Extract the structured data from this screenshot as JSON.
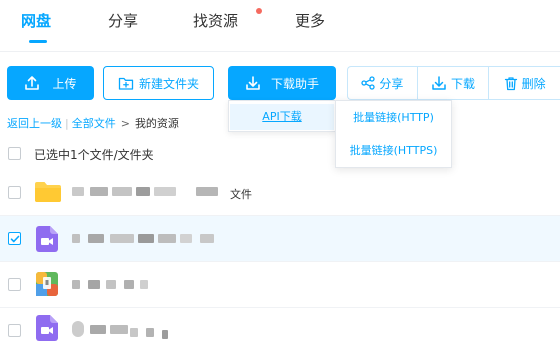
{
  "nav": {
    "tabs": [
      {
        "label": "网盘",
        "active": true
      },
      {
        "label": "分享",
        "active": false
      },
      {
        "label": "找资源",
        "active": false,
        "badge": "red-dot"
      },
      {
        "label": "更多",
        "active": false
      }
    ]
  },
  "toolbar": {
    "upload_label": "上传",
    "new_folder_label": "新建文件夹",
    "download_helper_label": "下载助手",
    "share_label": "分享",
    "download_label": "下载",
    "delete_label": "删除"
  },
  "api_menu": {
    "item": "API下载"
  },
  "batch_menu": {
    "items": [
      "批量链接(HTTP)",
      "批量链接(HTTPS)"
    ]
  },
  "breadcrumb": {
    "back": "返回上一级",
    "separator": "|",
    "all": "全部文件",
    "arrow": ">",
    "current": "我的资源"
  },
  "selection": {
    "text": "已选中1个文件/文件夹"
  },
  "files": [
    {
      "type": "folder",
      "icon": "folder-icon",
      "name_suffix": "文件",
      "selected": false
    },
    {
      "type": "video",
      "icon": "video-file-icon",
      "selected": true
    },
    {
      "type": "archive",
      "icon": "archive-file-icon",
      "selected": false
    },
    {
      "type": "video",
      "icon": "video-file-icon",
      "selected": false
    }
  ],
  "colors": {
    "accent": "#06a7ff",
    "badge": "#f56a5f",
    "folder": "#ffd24d",
    "video": "#8f6cf0"
  }
}
